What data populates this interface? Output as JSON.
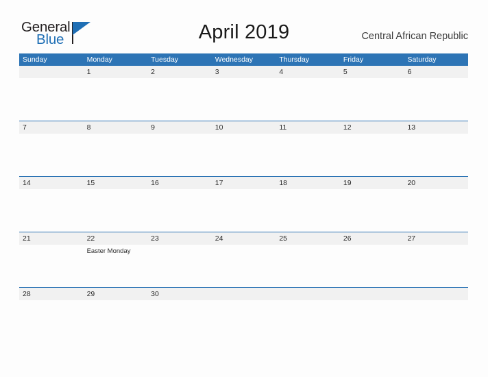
{
  "brand": {
    "name_part1": "General",
    "name_part2": "Blue",
    "logo_icon": "triangle-flag-icon",
    "color_primary": "#1f6fb5",
    "color_text": "#231f20"
  },
  "header": {
    "title": "April 2019",
    "subtitle": "Central African Republic"
  },
  "theme": {
    "header_blue": "#2d74b5",
    "row_band_gray": "#f1f1f1",
    "page_background": "#fdfdfd",
    "text_color": "#2a2a2a"
  },
  "calendar": {
    "month": "April",
    "year": "2019",
    "region": "Central African Republic",
    "weekdays": [
      "Sunday",
      "Monday",
      "Tuesday",
      "Wednesday",
      "Thursday",
      "Friday",
      "Saturday"
    ],
    "weeks": [
      {
        "days": [
          {
            "num": "",
            "event": ""
          },
          {
            "num": "1",
            "event": ""
          },
          {
            "num": "2",
            "event": ""
          },
          {
            "num": "3",
            "event": ""
          },
          {
            "num": "4",
            "event": ""
          },
          {
            "num": "5",
            "event": ""
          },
          {
            "num": "6",
            "event": ""
          }
        ]
      },
      {
        "days": [
          {
            "num": "7",
            "event": ""
          },
          {
            "num": "8",
            "event": ""
          },
          {
            "num": "9",
            "event": ""
          },
          {
            "num": "10",
            "event": ""
          },
          {
            "num": "11",
            "event": ""
          },
          {
            "num": "12",
            "event": ""
          },
          {
            "num": "13",
            "event": ""
          }
        ]
      },
      {
        "days": [
          {
            "num": "14",
            "event": ""
          },
          {
            "num": "15",
            "event": ""
          },
          {
            "num": "16",
            "event": ""
          },
          {
            "num": "17",
            "event": ""
          },
          {
            "num": "18",
            "event": ""
          },
          {
            "num": "19",
            "event": ""
          },
          {
            "num": "20",
            "event": ""
          }
        ]
      },
      {
        "days": [
          {
            "num": "21",
            "event": ""
          },
          {
            "num": "22",
            "event": "Easter Monday"
          },
          {
            "num": "23",
            "event": ""
          },
          {
            "num": "24",
            "event": ""
          },
          {
            "num": "25",
            "event": ""
          },
          {
            "num": "26",
            "event": ""
          },
          {
            "num": "27",
            "event": ""
          }
        ]
      },
      {
        "days": [
          {
            "num": "28",
            "event": ""
          },
          {
            "num": "29",
            "event": ""
          },
          {
            "num": "30",
            "event": ""
          },
          {
            "num": "",
            "event": ""
          },
          {
            "num": "",
            "event": ""
          },
          {
            "num": "",
            "event": ""
          },
          {
            "num": "",
            "event": ""
          }
        ]
      }
    ]
  }
}
